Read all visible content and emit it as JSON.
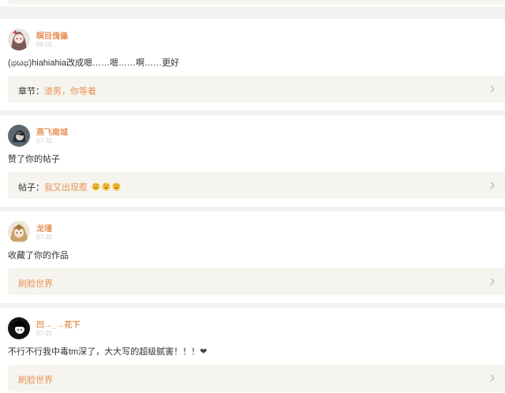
{
  "colors": {
    "accent": "#e8935a",
    "background": "#f2f2f2",
    "reference_bg": "#f6f4ee",
    "text": "#333333",
    "date": "#cccccc"
  },
  "items": [
    {
      "username": "瞑目傀儡",
      "date": "08-01",
      "content": "(ಥωಥ)hiahiahia改成嗯……嗯……啊……更好",
      "ref_prefix": "章节：",
      "ref_title": "渣男，你等着",
      "avatar_icon": "anime-avatar-icon"
    },
    {
      "username": "燕飞南城",
      "date": "07-31",
      "content": "赞了你的帖子",
      "ref_prefix": "帖子：",
      "ref_title": "我又出现惹",
      "ref_emoji": "grin-emoji-icon",
      "avatar_icon": "dark-character-avatar-icon"
    },
    {
      "username": "龙瑾",
      "date": "07-31",
      "content": "收藏了你的作品",
      "ref_prefix": "",
      "ref_title": "刷脸世界",
      "avatar_icon": "anime-avatar-icon"
    },
    {
      "username": "凹→_→花下",
      "date": "07-31",
      "content": "不行不行我中毒tm深了，大大写的超级腻害！！！",
      "content_suffix_icon": "heart-icon",
      "ref_prefix": "",
      "ref_title": "刷脸世界",
      "avatar_icon": "black-character-avatar-icon"
    }
  ]
}
